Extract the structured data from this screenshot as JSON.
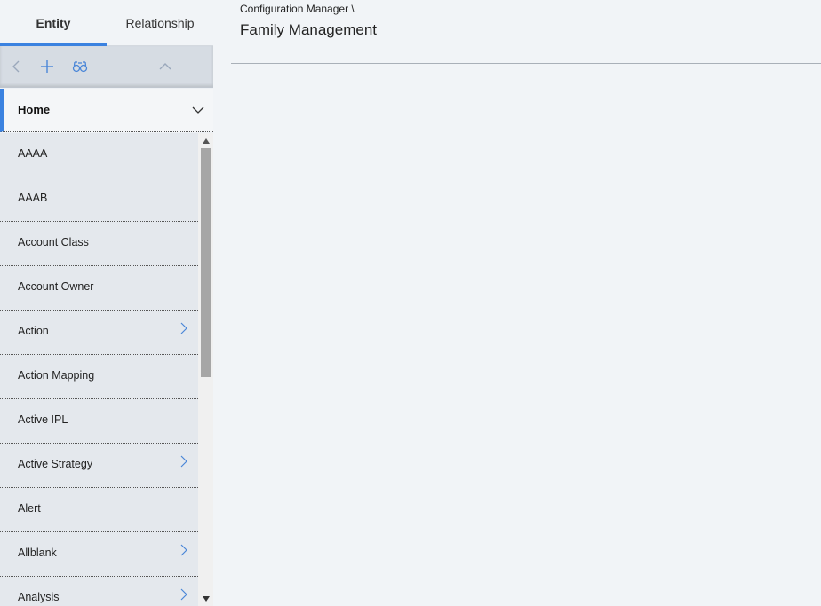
{
  "tabs": [
    {
      "label": "Entity",
      "active": true
    },
    {
      "label": "Relationship",
      "active": false
    }
  ],
  "toolbar": {
    "back_icon": "chevron-left-icon",
    "add_icon": "plus-icon",
    "search_icon": "binoculars-icon",
    "collapse_icon": "chevron-up-icon"
  },
  "home": {
    "label": "Home",
    "icon": "chevron-down-icon"
  },
  "list": {
    "items": [
      {
        "label": "AAAA",
        "has_children": false
      },
      {
        "label": "AAAB",
        "has_children": false
      },
      {
        "label": "Account Class",
        "has_children": false
      },
      {
        "label": "Account Owner",
        "has_children": false
      },
      {
        "label": "Action",
        "has_children": true
      },
      {
        "label": "Action Mapping",
        "has_children": false
      },
      {
        "label": "Active IPL",
        "has_children": false
      },
      {
        "label": "Active Strategy",
        "has_children": true
      },
      {
        "label": "Alert",
        "has_children": false
      },
      {
        "label": "Allblank",
        "has_children": true
      },
      {
        "label": "Analysis",
        "has_children": true
      }
    ]
  },
  "main": {
    "breadcrumb": "Configuration Manager \\",
    "title": "Family Management"
  },
  "colors": {
    "accent": "#3b82e0",
    "background": "#f1f4f7",
    "list_bg": "#e4e8ed",
    "toolbar_bg": "#d6dce3"
  }
}
